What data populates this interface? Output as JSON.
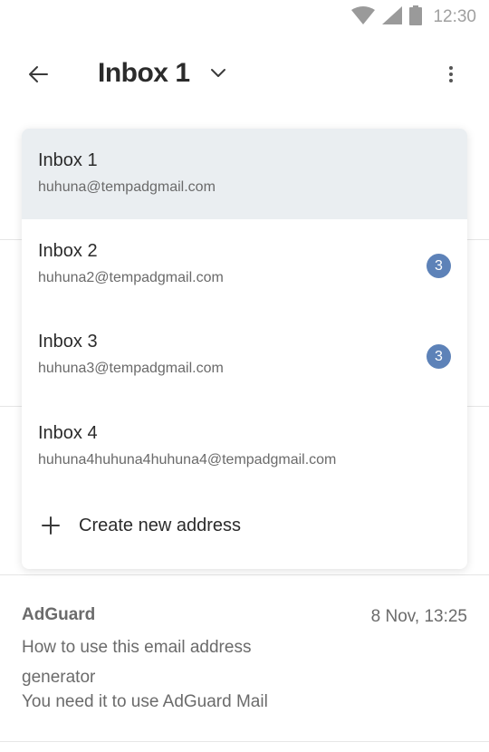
{
  "status_bar": {
    "time": "12:30",
    "icons": [
      "wifi-icon",
      "signal-icon",
      "battery-icon"
    ]
  },
  "app_bar": {
    "title": "Inbox 1",
    "back_icon": "arrow-left-icon",
    "dropdown_icon": "chevron-down-icon",
    "menu_icon": "more-vert-icon"
  },
  "dropdown": {
    "inboxes": [
      {
        "name": "Inbox 1",
        "email": "huhuna@tempadgmail.com",
        "badge": "",
        "selected": true
      },
      {
        "name": "Inbox 2",
        "email": "huhuna2@tempadgmail.com",
        "badge": "3",
        "selected": false
      },
      {
        "name": "Inbox 3",
        "email": "huhuna3@tempadgmail.com",
        "badge": "3",
        "selected": false
      },
      {
        "name": "Inbox 4",
        "email": "huhuna4huhuna4huhuna4@tempadgmail.com",
        "badge": "",
        "selected": false
      }
    ],
    "create_label": "Create new address"
  },
  "mail": {
    "sender": "AdGuard",
    "date": "8 Nov, 13:25",
    "subject": "How to use this email address generator",
    "preview": "You need it to use AdGuard Mail"
  },
  "colors": {
    "badge": "#5d82b8",
    "selected_bg": "#eaeef1",
    "text": "#2b2b2b",
    "muted": "#6b6b6b"
  }
}
